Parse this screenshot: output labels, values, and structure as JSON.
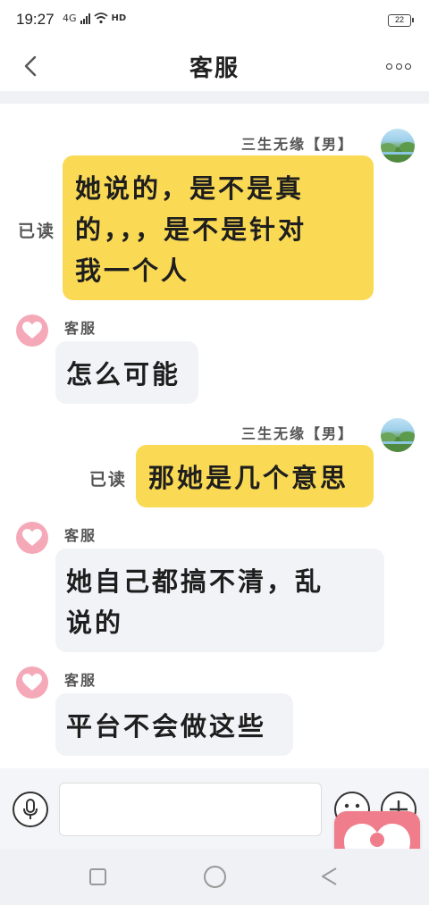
{
  "status_bar": {
    "time": "19:27",
    "network": "4G",
    "hd": "HD",
    "battery": "22"
  },
  "header": {
    "title": "客服"
  },
  "messages": [
    {
      "from": "user",
      "name": "三生无缘【男】",
      "text_lines": [
        "她说的，是不是真",
        "的，，，是不是针对",
        "我一个人"
      ],
      "read_label": "已读"
    },
    {
      "from": "service",
      "name": "客服",
      "text_lines": [
        "怎么可能"
      ]
    },
    {
      "from": "user",
      "name": "三生无缘【男】",
      "text_lines": [
        "那她是几个意思"
      ],
      "read_label": "已读"
    },
    {
      "from": "service",
      "name": "客服",
      "text_lines": [
        "她自己都搞不清，乱",
        "说的"
      ]
    },
    {
      "from": "service",
      "name": "客服",
      "text_lines": [
        "平台不会做这些"
      ]
    }
  ],
  "input": {
    "value": "",
    "placeholder": ""
  },
  "colors": {
    "my_bubble": "#fad955",
    "service_bubble": "#f2f3f7",
    "service_avatar": "#f5a9b8",
    "floating_button": "#ef7d8b"
  },
  "icons": {
    "back": "chevron-left-icon",
    "more": "more-dots-icon",
    "mic": "microphone-icon",
    "emoji": "emoji-icon",
    "plus": "plus-icon",
    "heart": "heart-icon"
  }
}
